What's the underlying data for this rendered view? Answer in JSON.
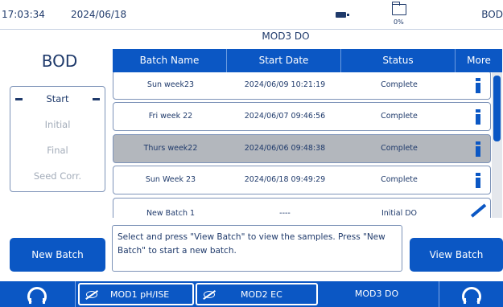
{
  "status_bar": {
    "time": "17:03:34",
    "date": "2024/06/18",
    "storage_percent": "0%",
    "mode": "BOD",
    "icons": [
      "battery-icon",
      "folder-icon"
    ]
  },
  "module_title": "MOD3 DO",
  "left_panel": {
    "title": "BOD",
    "steps": [
      {
        "label": "Start",
        "active": true
      },
      {
        "label": "Initial",
        "active": false
      },
      {
        "label": "Final",
        "active": false
      },
      {
        "label": "Seed Corr.",
        "active": false
      }
    ]
  },
  "table": {
    "columns": [
      "Batch Name",
      "Start Date",
      "Status",
      "More"
    ],
    "rows": [
      {
        "name": "Sun week23",
        "start": "2024/06/09 10:21:19",
        "status": "Complete",
        "action": "info-icon",
        "selected": false
      },
      {
        "name": "Fri week 22",
        "start": "2024/06/07 09:46:56",
        "status": "Complete",
        "action": "info-icon",
        "selected": false
      },
      {
        "name": "Thurs week22",
        "start": "2024/06/06 09:48:38",
        "status": "Complete",
        "action": "info-icon",
        "selected": true
      },
      {
        "name": "Sun Week 23",
        "start": "2024/06/18 09:49:29",
        "status": "Complete",
        "action": "info-icon",
        "selected": false
      },
      {
        "name": "New Batch 1",
        "start": "----",
        "status": "Initial DO",
        "action": "pencil-icon",
        "selected": false
      }
    ]
  },
  "message": "Select and press \"View Batch\" to view the samples. Press \"New Batch\" to start a new batch.",
  "buttons": {
    "new_batch": "New Batch",
    "view_batch": "View Batch"
  },
  "tabs": {
    "mod1": "MOD1 pH/ISE",
    "mod2": "MOD2 EC",
    "mod3": "MOD3 DO"
  },
  "colors": {
    "accent": "#0b57c4",
    "text": "#1f3a6b",
    "selected_row": "#b3b7bd",
    "disabled_text": "#a3acb9"
  }
}
